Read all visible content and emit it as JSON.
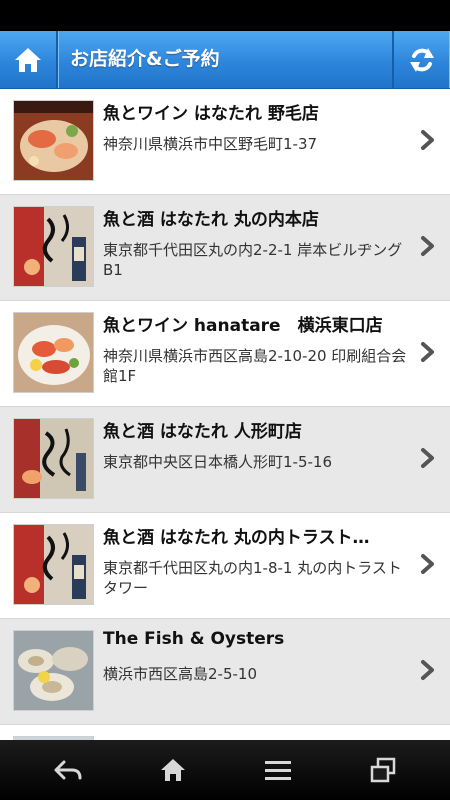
{
  "header": {
    "title": "お店紹介&ご予約",
    "home_icon": "home-icon",
    "refresh_icon": "refresh-icon",
    "accent": "#2e86dc"
  },
  "stores": [
    {
      "name": "魚とワイン はなたれ 野毛店",
      "address": "神奈川県横浜市中区野毛町1-37",
      "thumb": "seafood-platter"
    },
    {
      "name": "魚と酒 はなたれ 丸の内本店",
      "address": "東京都千代田区丸の内2-2-1 岸本ビルヂングB1",
      "thumb": "calligraphy-sake"
    },
    {
      "name": "魚とワイン hanatare　横浜東口店",
      "address": "神奈川県横浜市西区高島2-10-20 印刷組合会館1F",
      "thumb": "sashimi-plate"
    },
    {
      "name": "魚と酒 はなたれ 人形町店",
      "address": "東京都中央区日本橋人形町1-5-16",
      "thumb": "calligraphy-fish"
    },
    {
      "name": "魚と酒 はなたれ 丸の内トラスト…",
      "address": "東京都千代田区丸の内1-8-1 丸の内トラストタワー",
      "thumb": "calligraphy-sake"
    },
    {
      "name": "The Fish & Oysters",
      "address": "横浜市西区高島2-5-10",
      "thumb": "oysters"
    }
  ],
  "nav": {
    "back_icon": "back-icon",
    "home_icon": "home-icon",
    "menu_icon": "menu-icon",
    "recent_apps_icon": "recent-apps-icon"
  }
}
